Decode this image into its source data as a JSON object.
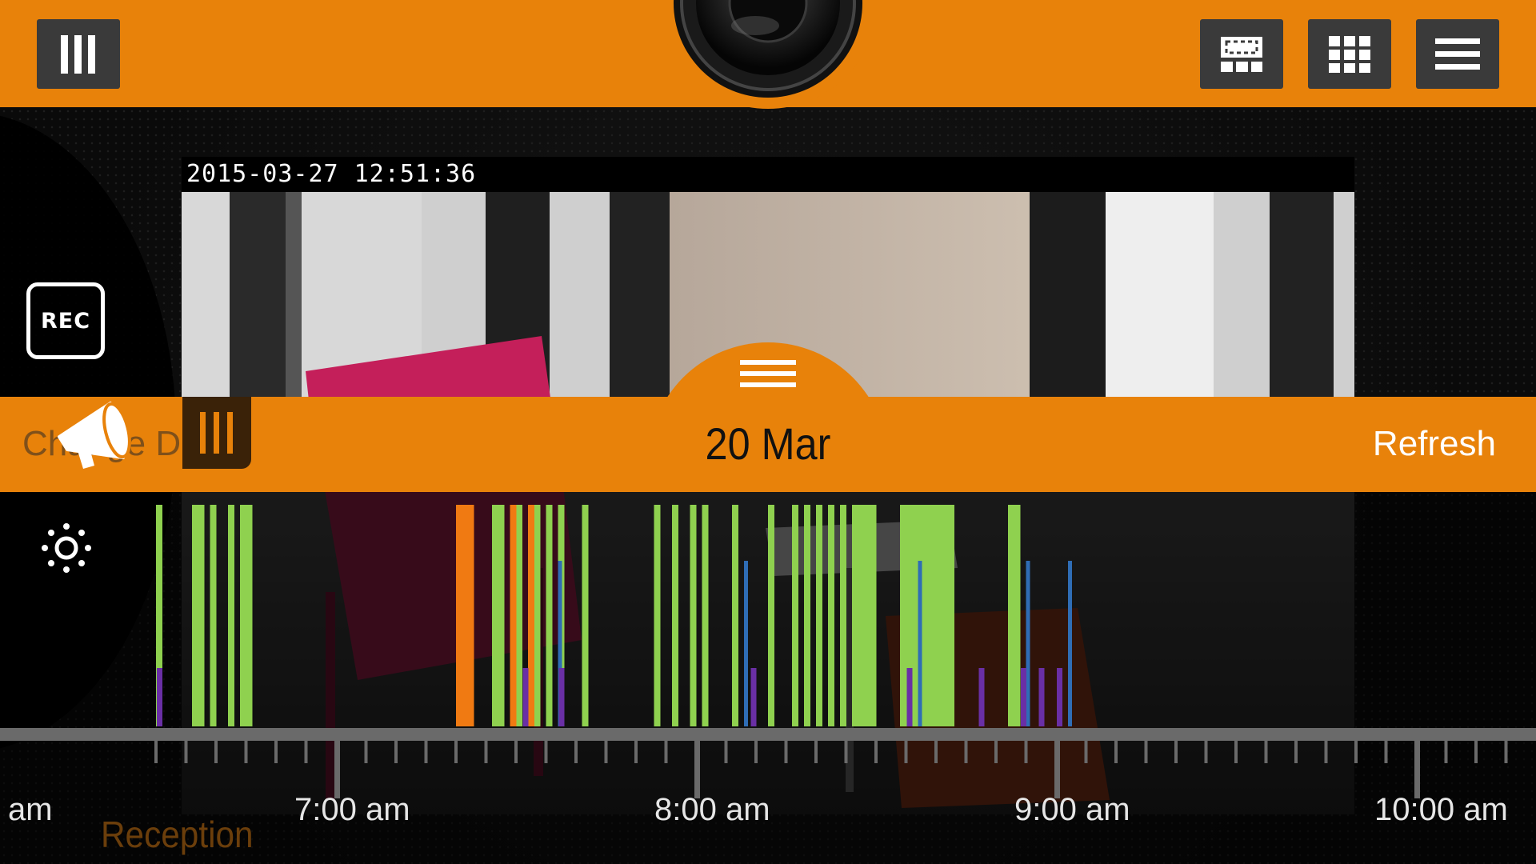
{
  "toolbar": {
    "menu_left_icon": "bars-vertical-icon",
    "layout_single_icon": "layout-single-icon",
    "grid_icon": "grid-icon",
    "menu_icon": "hamburger-icon",
    "logo_icon": "camera-lens-icon",
    "accent_color": "#e8820a"
  },
  "camera": {
    "timestamp": "2015-03-27 12:51:36",
    "name": "Reception"
  },
  "controls": {
    "rec_label": "REC",
    "announce_icon": "megaphone-icon",
    "settings_icon": "sun-icon",
    "change_date_label": "Change Date",
    "handle_icon": "bars-vertical-icon"
  },
  "datebar": {
    "date": "20 Mar",
    "refresh_label": "Refresh",
    "handle_icon": "hamburger-icon"
  },
  "timeline": {
    "hour_labels": [
      "am",
      "7:00 am",
      "8:00 am",
      "9:00 am",
      "10:00 am"
    ],
    "colors": {
      "motion": "#8fd14f",
      "alarm": "#f07a12",
      "event_blue": "#2f6db5",
      "event_purple": "#6a2fa5",
      "event_cyan": "#2aa6c9"
    }
  },
  "chart_data": {
    "type": "bar",
    "x_unit": "time of day",
    "x_range": [
      "6:30 am",
      "10:15 am"
    ],
    "series": [
      {
        "name": "motion",
        "color": "#8fd14f",
        "intervals": [
          [
            "6:30",
            "6:31"
          ],
          [
            "6:36",
            "6:37"
          ],
          [
            "6:37",
            "6:38"
          ],
          [
            "6:39",
            "6:40"
          ],
          [
            "6:42",
            "6:43"
          ],
          [
            "6:44",
            "6:45"
          ],
          [
            "6:45",
            "6:46"
          ],
          [
            "7:26",
            "7:27"
          ],
          [
            "7:27",
            "7:28"
          ],
          [
            "7:30",
            "7:31"
          ],
          [
            "7:33",
            "7:34"
          ],
          [
            "7:35",
            "7:36"
          ],
          [
            "7:37",
            "7:38"
          ],
          [
            "7:41",
            "7:42"
          ],
          [
            "7:53",
            "7:54"
          ],
          [
            "7:56",
            "7:57"
          ],
          [
            "7:59",
            "8:00"
          ],
          [
            "8:01",
            "8:02"
          ],
          [
            "8:06",
            "8:07"
          ],
          [
            "8:12",
            "8:13"
          ],
          [
            "8:16",
            "8:17"
          ],
          [
            "8:18",
            "8:19"
          ],
          [
            "8:20",
            "8:21"
          ],
          [
            "8:22",
            "8:23"
          ],
          [
            "8:24",
            "8:25"
          ],
          [
            "8:26",
            "8:27"
          ],
          [
            "8:27",
            "8:28"
          ],
          [
            "8:28",
            "8:29"
          ],
          [
            "8:29",
            "8:30"
          ],
          [
            "8:34",
            "8:35"
          ],
          [
            "8:35",
            "8:36"
          ],
          [
            "8:36",
            "8:37"
          ],
          [
            "8:37",
            "8:38"
          ],
          [
            "8:38",
            "8:39"
          ],
          [
            "8:39",
            "8:40"
          ],
          [
            "8:40",
            "8:41"
          ],
          [
            "8:41",
            "8:42"
          ],
          [
            "8:42",
            "8:43"
          ],
          [
            "8:52",
            "8:53"
          ],
          [
            "8:53",
            "8:54"
          ]
        ]
      },
      {
        "name": "alarm",
        "color": "#f07a12",
        "intervals": [
          [
            "7:20",
            "7:23"
          ],
          [
            "7:29",
            "7:30"
          ],
          [
            "7:32",
            "7:33"
          ]
        ]
      },
      {
        "name": "event_blue",
        "color": "#2f6db5",
        "intervals": [
          [
            "7:37",
            "7:38"
          ],
          [
            "8:08",
            "8:09"
          ],
          [
            "8:37",
            "8:38"
          ],
          [
            "8:55",
            "8:56"
          ],
          [
            "9:02",
            "9:03"
          ]
        ]
      }
    ]
  }
}
